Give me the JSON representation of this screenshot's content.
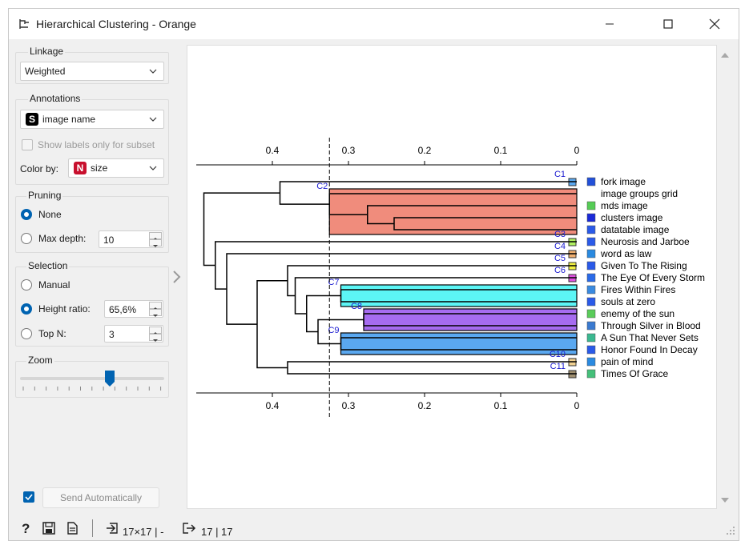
{
  "window": {
    "title": "Hierarchical Clustering - Orange"
  },
  "linkage": {
    "group_title": "Linkage",
    "value": "Weighted"
  },
  "annotations": {
    "group_title": "Annotations",
    "value": "image name",
    "value_badge": "S",
    "subset_label": "Show labels only for subset",
    "color_by_label": "Color by:",
    "color_by_value": "size",
    "color_by_badge": "N"
  },
  "pruning": {
    "group_title": "Pruning",
    "none_label": "None",
    "max_depth_label": "Max depth:",
    "max_depth_value": "10",
    "selected": "None"
  },
  "selection": {
    "group_title": "Selection",
    "manual_label": "Manual",
    "height_ratio_label": "Height ratio:",
    "height_ratio_value": "65,6%",
    "top_n_label": "Top N:",
    "top_n_value": "3",
    "selected": "Height ratio"
  },
  "zoom": {
    "group_title": "Zoom",
    "level_fraction": 0.62
  },
  "send": {
    "auto_checked": true,
    "button_label": "Send Automatically"
  },
  "status": {
    "input_summary": "17×17 | -",
    "output_summary": "17 | 17"
  },
  "colors": {
    "accent": "#0063b1",
    "badge_string": "#000000",
    "badge_numeric": "#c8102e",
    "c2": "#f08c7c",
    "c7": "#5cf5f5",
    "c8": "#a66cf0",
    "c9": "#5aa8f0",
    "link": "#000000"
  },
  "chart_data": {
    "type": "dendrogram",
    "axis_ticks": [
      "0.4",
      "0.3",
      "0.2",
      "0.1",
      "0"
    ],
    "axis_tick_values": [
      0.4,
      0.3,
      0.2,
      0.1,
      0
    ],
    "axis_range": [
      0.5,
      0
    ],
    "cut_height": 0.325,
    "leaves": [
      {
        "label": "fork image",
        "color": "#2250d8"
      },
      {
        "label": "image groups grid",
        "color": ""
      },
      {
        "label": "mds image",
        "color": "#55cc55"
      },
      {
        "label": "clusters image",
        "color": "#1a2ad8"
      },
      {
        "label": "datatable image",
        "color": "#2a5ae8"
      },
      {
        "label": "Neurosis and Jarboe",
        "color": "#2a5ae8"
      },
      {
        "label": "word as law",
        "color": "#2a8ae0"
      },
      {
        "label": "Given To The Rising",
        "color": "#2a5ae8"
      },
      {
        "label": "The Eye Of Every Storm",
        "color": "#2a6ae8"
      },
      {
        "label": "Fires Within Fires",
        "color": "#3a8ae0"
      },
      {
        "label": "souls at zero",
        "color": "#2a5ae8"
      },
      {
        "label": "enemy of the sun",
        "color": "#5acc5a"
      },
      {
        "label": "Through Silver in Blood",
        "color": "#3a7ad0"
      },
      {
        "label": "A Sun That Never Sets",
        "color": "#3ab890"
      },
      {
        "label": "Honor Found In Decay",
        "color": "#2a5ae8"
      },
      {
        "label": "pain of mind",
        "color": "#2a8ae0"
      },
      {
        "label": "Times Of Grace",
        "color": "#45c07a"
      }
    ],
    "clusters": [
      {
        "label": "C1",
        "leaf_start": 0,
        "leaf_end": 0,
        "color": "#5aa8f0"
      },
      {
        "label": "C2",
        "leaf_start": 1,
        "leaf_end": 4,
        "color": "#f08c7c"
      },
      {
        "label": "C3",
        "leaf_start": 5,
        "leaf_end": 5,
        "color": "#b0f060"
      },
      {
        "label": "C4",
        "leaf_start": 6,
        "leaf_end": 6,
        "color": "#f0b070"
      },
      {
        "label": "C5",
        "leaf_start": 7,
        "leaf_end": 7,
        "color": "#f0f040"
      },
      {
        "label": "C6",
        "leaf_start": 8,
        "leaf_end": 8,
        "color": "#e050e0"
      },
      {
        "label": "C7",
        "leaf_start": 9,
        "leaf_end": 10,
        "color": "#5cf5f5"
      },
      {
        "label": "C8",
        "leaf_start": 11,
        "leaf_end": 12,
        "color": "#a66cf0"
      },
      {
        "label": "C9",
        "leaf_start": 13,
        "leaf_end": 14,
        "color": "#5aa8f0"
      },
      {
        "label": "C10",
        "leaf_start": 15,
        "leaf_end": 15,
        "color": "#f0d090"
      },
      {
        "label": "C11",
        "leaf_start": 16,
        "leaf_end": 16,
        "color": "#a09070"
      }
    ],
    "merges": [
      {
        "a": "L3",
        "b": "L4",
        "height": 0.24,
        "id": "m1"
      },
      {
        "a": "L2",
        "b": "m1",
        "height": 0.275,
        "id": "m2"
      },
      {
        "a": "L1",
        "b": "m2",
        "height": 0.325,
        "id": "m3"
      },
      {
        "a": "L0",
        "b": "m3",
        "height": 0.39,
        "id": "m4"
      },
      {
        "a": "L9",
        "b": "L10",
        "height": 0.31,
        "id": "m5"
      },
      {
        "a": "L11",
        "b": "L12",
        "height": 0.28,
        "id": "m6"
      },
      {
        "a": "L13",
        "b": "L14",
        "height": 0.31,
        "id": "m7"
      },
      {
        "a": "m6",
        "b": "m7",
        "height": 0.34,
        "id": "m8"
      },
      {
        "a": "m5",
        "b": "m8",
        "height": 0.355,
        "id": "m9"
      },
      {
        "a": "L8",
        "b": "m9",
        "height": 0.37,
        "id": "m10"
      },
      {
        "a": "L7",
        "b": "m10",
        "height": 0.38,
        "id": "m11"
      },
      {
        "a": "L15",
        "b": "L16",
        "height": 0.38,
        "id": "m12"
      },
      {
        "a": "m11",
        "b": "m12",
        "height": 0.42,
        "id": "m13"
      },
      {
        "a": "L6",
        "b": "m13",
        "height": 0.46,
        "id": "m14"
      },
      {
        "a": "L5",
        "b": "m14",
        "height": 0.475,
        "id": "m15"
      },
      {
        "a": "m4",
        "b": "m15",
        "height": 0.49,
        "id": "m16"
      }
    ]
  }
}
